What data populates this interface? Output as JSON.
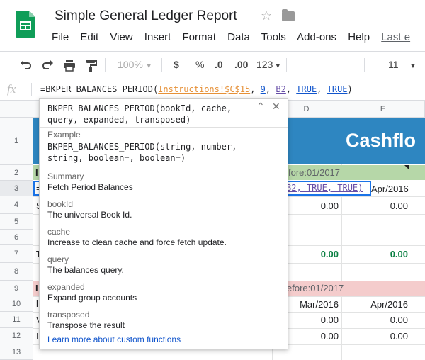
{
  "app": {
    "title": "Simple General Ledger Report",
    "star_icon": "star-icon",
    "folder_icon": "folder-icon"
  },
  "menu": {
    "items": [
      "File",
      "Edit",
      "View",
      "Insert",
      "Format",
      "Data",
      "Tools",
      "Add-ons",
      "Help"
    ],
    "last_edit": "Last e"
  },
  "toolbar": {
    "zoom": "100%",
    "currency": "$",
    "percent": "%",
    "decimal_decrease": ".0",
    "decimal_increase": ".00",
    "more_formats": "123",
    "font_size": "11"
  },
  "formula_bar": {
    "fx": "fx",
    "parts": {
      "fn": "=BKPER_BALANCES_PERIOD(",
      "a1": "Instructions!$C$15",
      "sep1": ", ",
      "a2": "9",
      "sep2": ", ",
      "a3": "B2",
      "sep3": ", ",
      "a4": "TRUE",
      "sep4": ", ",
      "a5": "TRUE",
      "close": ")"
    }
  },
  "grid": {
    "columns": [
      "D",
      "E"
    ],
    "rows": [
      "1",
      "2",
      "3",
      "4",
      "5",
      "6",
      "7",
      "8",
      "9",
      "10",
      "11",
      "12",
      "13"
    ],
    "banner_title": "Cashflo",
    "row2_text": "fore:01/2017",
    "row9_text": "efore:01/2017",
    "edit_tail": "B2, TRUE, TRUE)",
    "row3_e": "Apr/2016",
    "row4": [
      "0.00",
      "0.00"
    ],
    "row7": [
      "0.00",
      "0.00"
    ],
    "row10": [
      "Mar/2016",
      "Apr/2016"
    ],
    "row11": [
      "0.00",
      "0.00"
    ],
    "row12": [
      "0.00",
      "0.00"
    ],
    "row2_a": "I",
    "row3_a": "=",
    "row4_a": "S",
    "row7_a": "T",
    "row9_a": "I",
    "row10_a": "I",
    "row11_a": "V",
    "row12_a": "I"
  },
  "tooltip": {
    "signature": "BKPER_BALANCES_PERIOD(bookId, cache, query, expanded, transposed)",
    "example_label": "Example",
    "example": "BKPER_BALANCES_PERIOD(string, number, string, boolean=, boolean=)",
    "summary_label": "Summary",
    "summary": "Fetch Period Balances",
    "params": [
      {
        "name": "bookId",
        "desc": "The universal Book Id."
      },
      {
        "name": "cache",
        "desc": "Increase to clean cache and force fetch update."
      },
      {
        "name": "query",
        "desc": "The balances query."
      },
      {
        "name": "expanded",
        "desc": "Expand group accounts"
      },
      {
        "name": "transposed",
        "desc": "Transpose the result"
      }
    ],
    "learn_more": "Learn more about custom functions"
  },
  "colors": {
    "banner": "#2e86c1",
    "green_band": "#b6d7a8",
    "red_band": "#f4cccc",
    "total_green": "#0b8043",
    "link": "#1155cc"
  }
}
